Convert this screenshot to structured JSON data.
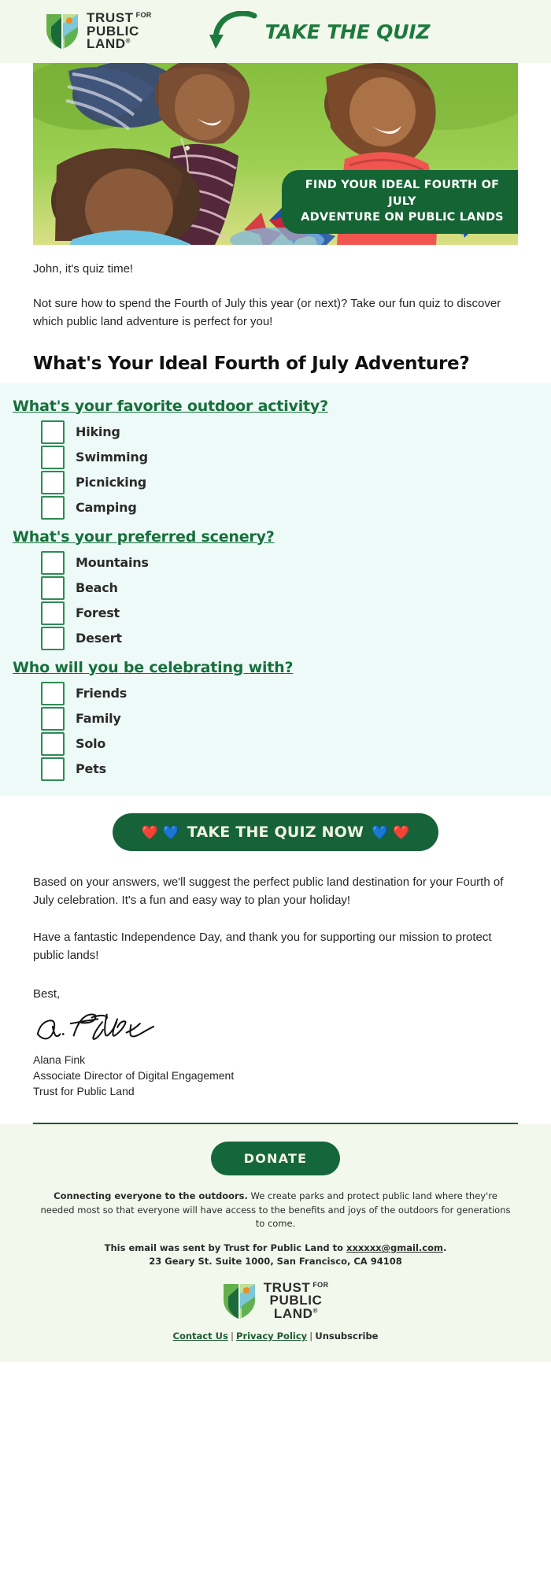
{
  "colors": {
    "brand_green": "#16633a",
    "link_green": "#16703c",
    "header_bg": "#f3f8ec",
    "quiz_panel_bg": "#eefaf7",
    "checkbox_border": "#2f8a55",
    "cta_text": "#f4f3e2"
  },
  "header": {
    "logo_line1": "TRUST",
    "logo_for": "FOR",
    "logo_line2": "PUBLIC",
    "logo_line3": "LAND",
    "logo_reg": "®",
    "cta_text": "TAKE THE QUIZ",
    "arrow_icon": "curved-down-arrow-icon"
  },
  "hero": {
    "banner_line1": "FIND YOUR IDEAL FOURTH OF JULY",
    "banner_line2": "ADVENTURE ON PUBLIC LANDS",
    "photo_alt": "family-celebrating-with-pinwheels-photo"
  },
  "body": {
    "greeting": "John, it's quiz time!",
    "intro": "Not sure how to spend the Fourth of July this year (or next)? Take our fun quiz to discover which public land adventure is perfect for you!",
    "main_heading": "What's Your Ideal Fourth of July Adventure?"
  },
  "quiz": {
    "questions": [
      {
        "title": "What's your favorite outdoor activity?",
        "options": [
          "Hiking",
          "Swimming",
          "Picnicking",
          "Camping"
        ]
      },
      {
        "title": "What's your preferred scenery?",
        "options": [
          "Mountains",
          "Beach",
          "Forest",
          "Desert"
        ]
      },
      {
        "title": "Who will you be celebrating with?",
        "options": [
          "Friends",
          "Family",
          "Solo",
          "Pets"
        ]
      }
    ]
  },
  "cta": {
    "heart_red_left": "❤️",
    "heart_blue_left": "💙",
    "label": "TAKE THE QUIZ NOW",
    "heart_blue_right": "💙",
    "heart_red_right": "❤️"
  },
  "closing": {
    "paragraph1": "Based on your answers, we'll suggest the perfect public land destination for your Fourth of July celebration. It's a fun and easy way to plan your holiday!",
    "paragraph2": "Have a fantastic Independence Day, and thank you for supporting our mission to protect public lands!",
    "signoff": "Best,",
    "signature_text": "A. Fink",
    "name": "Alana Fink",
    "title": "Associate Director of Digital Engagement",
    "org": "Trust for Public Land"
  },
  "footer": {
    "donate_label": "DONATE",
    "mission_bold": "Connecting everyone to the outdoors.",
    "mission_rest": " We create parks and protect public land where they're needed most so that everyone will have access to the benefits and joys of the outdoors for generations to come.",
    "sent_prefix": "This email was sent by Trust for Public Land to ",
    "sent_email": "xxxxxx@gmail.com",
    "sent_suffix": ".",
    "address": "23 Geary St. Suite 1000, San Francisco, CA 94108",
    "logo_line1": "TRUST",
    "logo_for": "FOR",
    "logo_line2": "PUBLIC",
    "logo_line3": "LAND",
    "logo_reg": "®",
    "link_contact": "Contact Us",
    "link_privacy": "Privacy Policy",
    "link_unsubscribe": "Unsubscribe",
    "sep": "|"
  }
}
